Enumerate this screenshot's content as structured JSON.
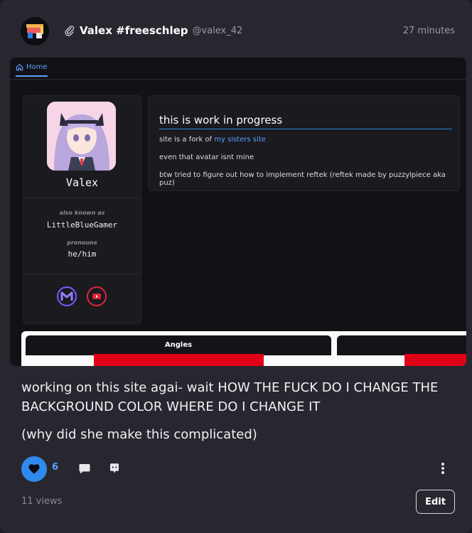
{
  "post": {
    "author_name": "Valex #freeschlep",
    "author_handle": "@valex_42",
    "time": "27 minutes",
    "body_line1": "working on this site agai- wait HOW THE FUCK DO I CHANGE THE BACKGROUND COLOR WHERE DO I CHANGE IT",
    "body_line2": "(why did she make this complicated)",
    "like_count": "6",
    "views": "11 views",
    "edit_label": "Edit"
  },
  "embed": {
    "nav_home": "Home",
    "profile_name": "Valex",
    "aka_label": "also known as",
    "aka_value": "LittleBlueGamer",
    "pronouns_label": "pronouns",
    "pronouns_value": "he/him",
    "main_title": "this is work in progress",
    "line1_prefix": "site is a fork of ",
    "line1_link": "my sisters site",
    "line2": "even that avatar isnt mine",
    "line3": "btw tried to figure out how to implement reftek (reftek made by puzzylpiece aka puz)",
    "angles_title": "Angles"
  },
  "colors": {
    "accent": "#2f8af0",
    "link": "#5aa0ff",
    "card_bg": "#28272f",
    "page_bg": "#1b1a22"
  },
  "icons": [
    "attachment-icon",
    "home-icon",
    "heart-icon",
    "comment-icon",
    "repost-icon",
    "more-vertical-icon",
    "mastodon-icon",
    "youtube-icon"
  ]
}
